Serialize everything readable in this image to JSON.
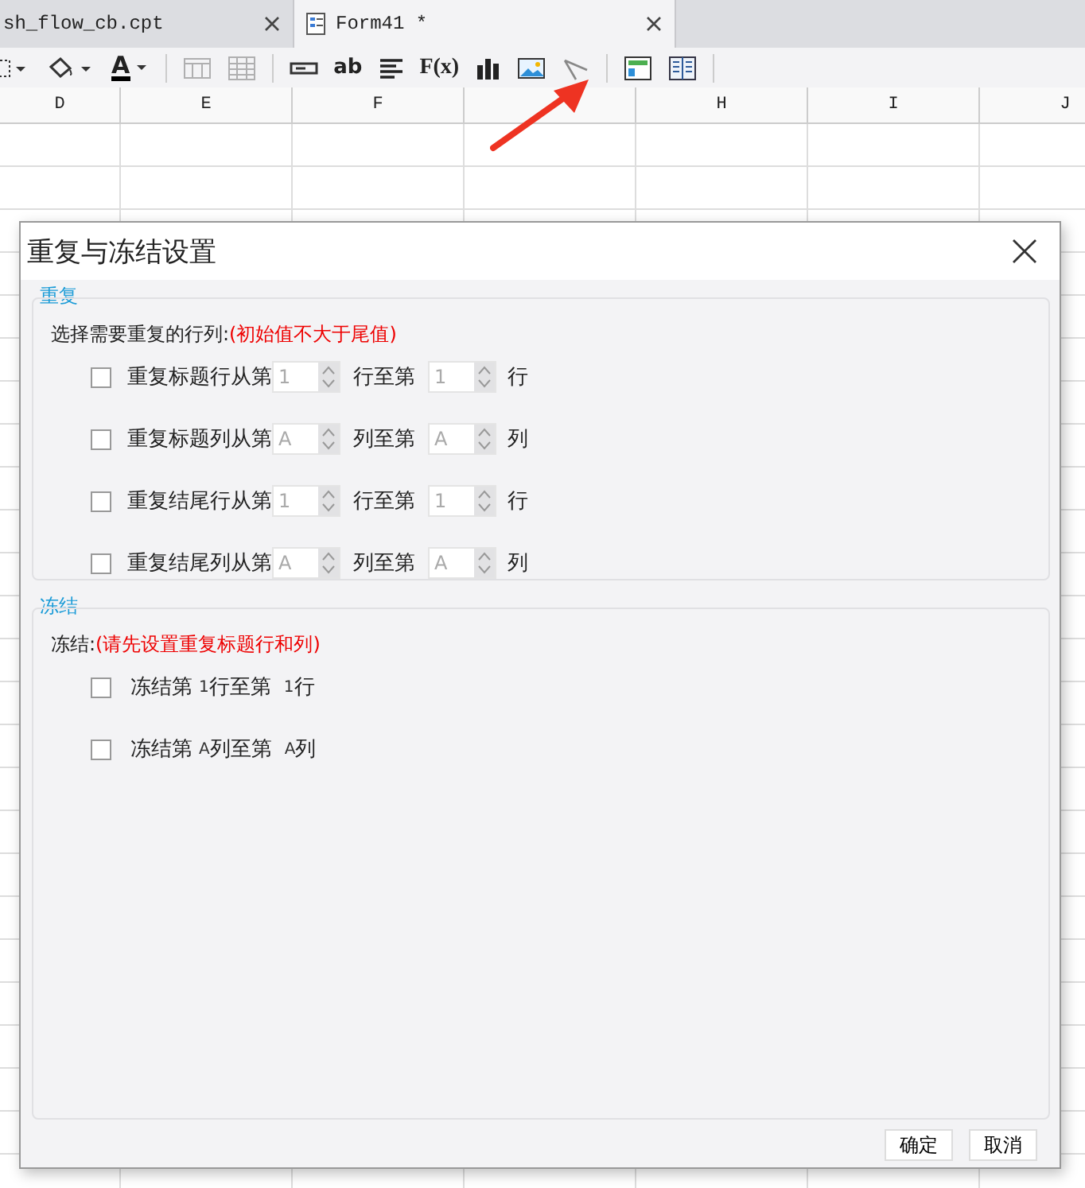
{
  "tabs": [
    {
      "label": "sh_flow_cb.cpt",
      "selected": false,
      "icon": false
    },
    {
      "label": "Form41 *",
      "selected": true,
      "icon": true
    }
  ],
  "toolbar": [
    {
      "kind": "border"
    },
    {
      "kind": "fill"
    },
    {
      "kind": "fontcolor",
      "text": "A"
    },
    {
      "kind": "sep"
    },
    {
      "kind": "merge",
      "disabled": true
    },
    {
      "kind": "grid",
      "disabled": true
    },
    {
      "kind": "sep"
    },
    {
      "kind": "field"
    },
    {
      "kind": "textlabel",
      "text": "ab"
    },
    {
      "kind": "align"
    },
    {
      "kind": "formula",
      "text": "F(x)"
    },
    {
      "kind": "chart"
    },
    {
      "kind": "image"
    },
    {
      "kind": "slash"
    },
    {
      "kind": "sep"
    },
    {
      "kind": "layout"
    },
    {
      "kind": "list"
    },
    {
      "kind": "sep"
    }
  ],
  "columns": [
    {
      "label": "D"
    },
    {
      "label": "E"
    },
    {
      "label": "F"
    },
    {},
    {
      "label": "H"
    },
    {
      "label": "I"
    },
    {
      "label": "J"
    }
  ],
  "dialog": {
    "title": "重复与冻结设置",
    "repeat": {
      "legend": "重复",
      "prompt": "选择需要重复的行列:",
      "prompt_note": "(初始值不大于尾值)",
      "rows": [
        {
          "checked": false,
          "label": "重复标题行从第",
          "from": "1",
          "middle": "行至第",
          "to": "1",
          "unit": "行",
          "disabled": true
        },
        {
          "checked": false,
          "label": "重复标题列从第",
          "from": "A",
          "middle": "列至第",
          "to": "A",
          "unit": "列",
          "disabled": true
        },
        {
          "checked": false,
          "label": "重复结尾行从第",
          "from": "1",
          "middle": "行至第",
          "to": "1",
          "unit": "行",
          "disabled": true
        },
        {
          "checked": false,
          "label": "重复结尾列从第",
          "from": "A",
          "middle": "列至第",
          "to": "A",
          "unit": "列",
          "disabled": true
        }
      ]
    },
    "freeze": {
      "legend": "冻结",
      "prompt": "冻结:",
      "prompt_note": "(请先设置重复标题行和列)",
      "rows": [
        {
          "checked": false,
          "label": "冻结第",
          "from": "1",
          "middle": "行至第",
          "to": "1",
          "unit": "行"
        },
        {
          "checked": false,
          "label": "冻结第",
          "from": "A",
          "middle": "列至第",
          "to": "A",
          "unit": "列"
        }
      ]
    },
    "buttons": [
      "确定",
      "取消"
    ]
  }
}
